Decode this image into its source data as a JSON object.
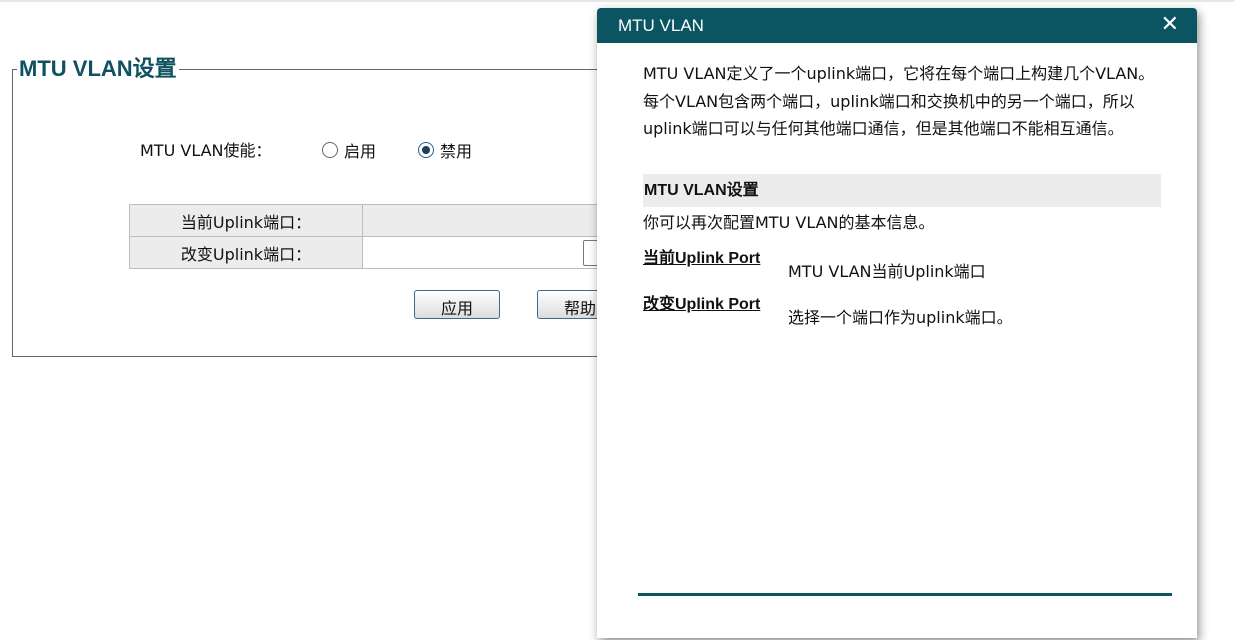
{
  "page": {
    "section_title": "MTU VLAN设置",
    "enable_label": "MTU VLAN使能：",
    "radio_enable": "启用",
    "radio_disable": "禁用",
    "selected": "禁用",
    "table": [
      {
        "label": "当前Uplink端口：",
        "value": ""
      },
      {
        "label": "改变Uplink端口：",
        "value": ""
      }
    ],
    "apply_button": "应用",
    "help_button": "帮助"
  },
  "dialog": {
    "title": "MTU VLAN",
    "close_glyph": "✕",
    "intro": "MTU VLAN定义了一个uplink端口，它将在每个端口上构建几个VLAN。每个VLAN包含两个端口，uplink端口和交换机中的另一个端口，所以uplink端口可以与任何其他端口通信，但是其他端口不能相互通信。",
    "section_heading": "MTU VLAN设置",
    "section_desc": "你可以再次配置MTU VLAN的基本信息。",
    "terms": [
      {
        "term": "当前Uplink Port",
        "desc": "MTU VLAN当前Uplink端口"
      },
      {
        "term": "改变Uplink Port",
        "desc": "选择一个端口作为uplink端口。"
      }
    ]
  },
  "colors": {
    "accent": "#0b5563",
    "heading": "#0f5160"
  }
}
